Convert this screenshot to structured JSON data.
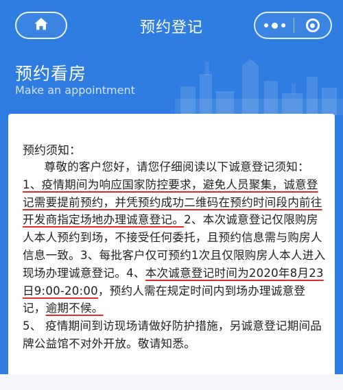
{
  "nav": {
    "title": "预约登记",
    "home_icon": "home-icon",
    "more_icon": "more-dots-icon",
    "close_icon": "target-circle-icon"
  },
  "banner": {
    "title": "预约看房",
    "subtitle": "Make an appointment"
  },
  "notice": {
    "heading": "预约须知：",
    "intro": "尊敬的客户您好，请您仔细阅读以下诚意登记须知：",
    "item1_highlight": "1、疫情期间为响应国家防控要求，避免人员聚集，诚意登记需要提前预约，并凭预约成功二维码在预约时间段内前往开发商指定场地办理诚意登记。",
    "item2": "2、本次诚意登记仅限购房人本人预约到场，不接受任何委托，且预约信息需与购房人信息一致。",
    "item3": "3、每批客户仅可预约1次且仅限购房人本人进入现场办理诚意登记。",
    "item4_prefix": "4、",
    "item4_highlight": "本次诚意登记时间为2020年8月23日9:00-20:00",
    "item4_middle": "，预约人需在规定时间内到场办理诚意登记，",
    "item4_highlight2": "逾期不候。",
    "item5": "5、 疫情期间到访现场请做好防护措施，另诚意登记期间品牌公益馆不对外开放。敬请知悉。"
  },
  "colors": {
    "header_blue": "#2f7de1",
    "underline_red": "#e02a2a",
    "text": "#222222"
  }
}
